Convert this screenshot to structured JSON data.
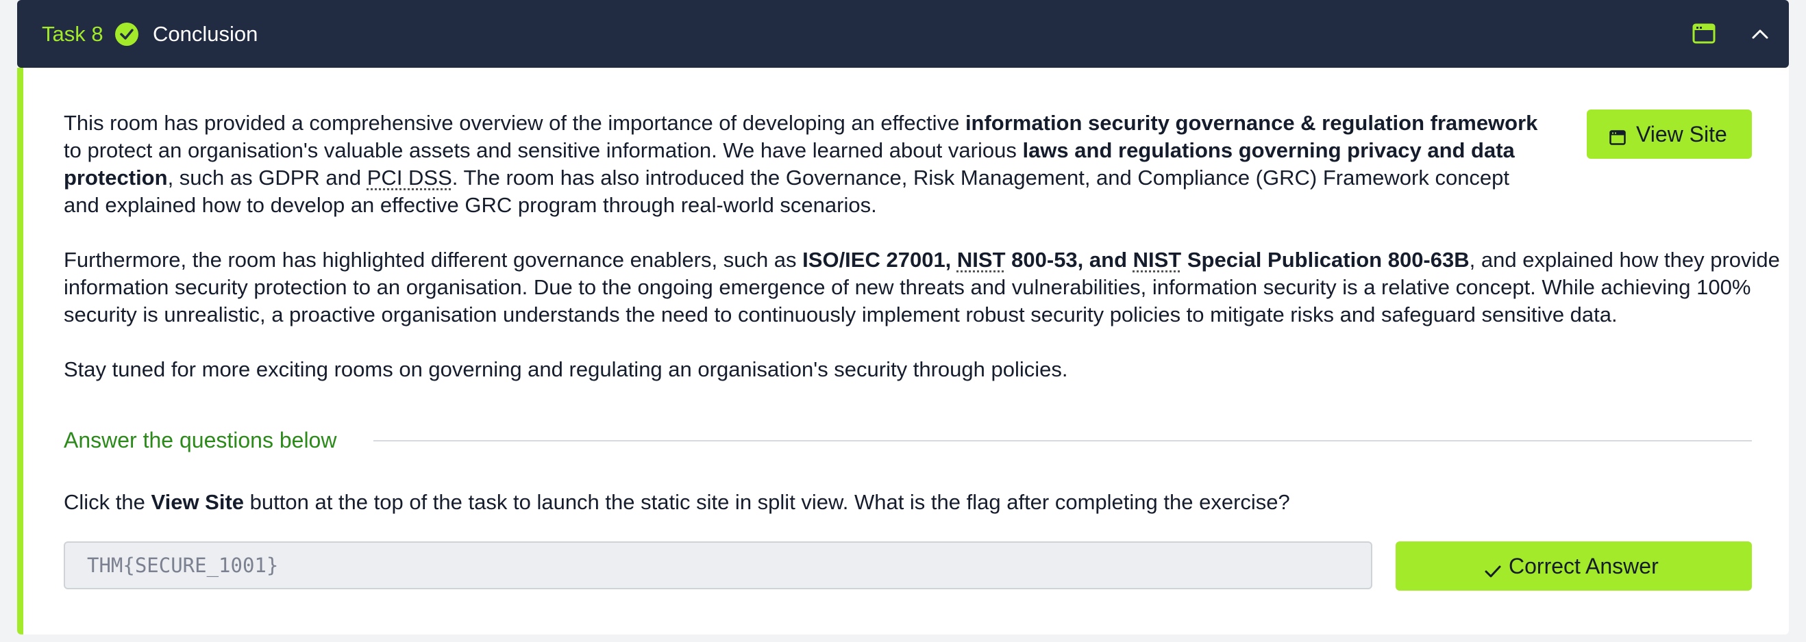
{
  "header": {
    "task_number": "Task 8",
    "title": "Conclusion",
    "status_icon": "check-circle-icon",
    "accent": "#a3ea2a",
    "background": "#212c42"
  },
  "view_site_button": {
    "label": "View Site",
    "icon": "split-view-icon"
  },
  "content": {
    "p1": {
      "t1": "This room has provided a comprehensive overview of the importance of developing an effective ",
      "b1": "information security governance & regulation framework",
      "t2": " to protect an organisation's valuable assets and sensitive information. We have learned about various ",
      "b2": "laws and regulations governing privacy and data protection",
      "t3": ", such as GDPR and ",
      "abbr1": "PCI DSS",
      "t4": ". The room has also introduced the Governance, Risk Management, and Compliance (GRC) Framework concept and explained how to develop an effective GRC program through real-world scenarios."
    },
    "p2": {
      "t1": "Furthermore, the room has highlighted different governance enablers, such as ",
      "b1": "ISO/IEC 27001, ",
      "abbr1": "NIST",
      "b2": " 800-53, and ",
      "abbr2": "NIST",
      "b3": " Special Publication 800-63B",
      "t2": ", and explained how they provide information security protection to an organisation. Due to the ongoing emergence of new threats and vulnerabilities, information security is a relative concept. While achieving 100% security is unrealistic, a proactive organisation understands the need to continuously implement robust security policies to mitigate risks and safeguard sensitive data."
    },
    "p3": "Stay tuned for more exciting rooms on governing and regulating an organisation's security through policies."
  },
  "questions": {
    "heading": "Answer the questions below",
    "q1": {
      "t1": "Click the ",
      "b1": "View Site",
      "t2": " button at the top of the task to launch the static site in split view. What is the flag after completing the exercise?",
      "answer_value": "THM{SECURE_1001}",
      "submit_label": "Correct Answer",
      "submit_icon": "checkmark-icon"
    }
  }
}
